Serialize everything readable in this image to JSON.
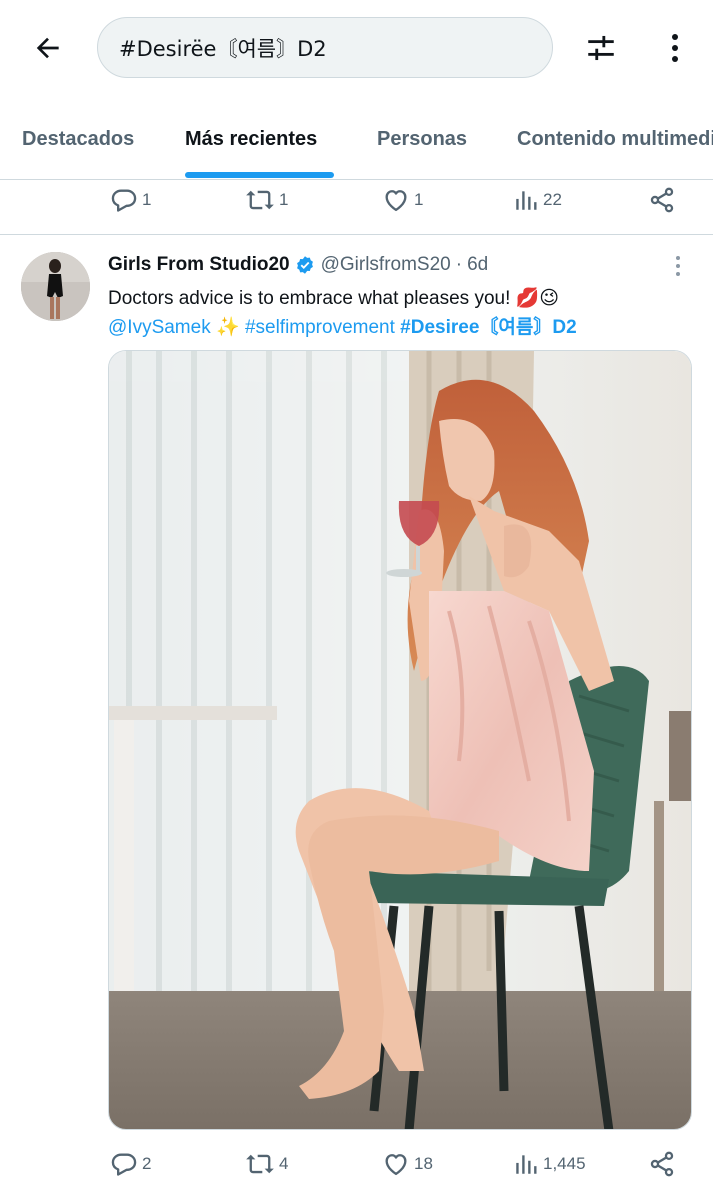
{
  "search": {
    "query": "#Desirëe〘여름〙D2"
  },
  "tabs": [
    {
      "label": "Destacados"
    },
    {
      "label": "Más recientes"
    },
    {
      "label": "Personas"
    },
    {
      "label": "Contenido multimedia"
    }
  ],
  "prev_post_actions": {
    "replies": "1",
    "reposts": "1",
    "likes": "1",
    "views": "22"
  },
  "post": {
    "author_name": "Girls From Studio20",
    "handle": "@GirlsfromS20",
    "separator": "·",
    "time": "6d",
    "text_line1": "Doctors advice is to embrace what pleases you!",
    "text_emojis": "💋😉",
    "mention": "@IvySamek",
    "sparkles": "✨",
    "hashtag1": "#selfimprovement",
    "hashtag2": "#Desiree〘여름〙D2",
    "actions": {
      "replies": "2",
      "reposts": "4",
      "likes": "18",
      "views": "1,445"
    }
  },
  "colors": {
    "accent": "#1d9bf0",
    "text": "#0f1419",
    "muted": "#536471"
  }
}
